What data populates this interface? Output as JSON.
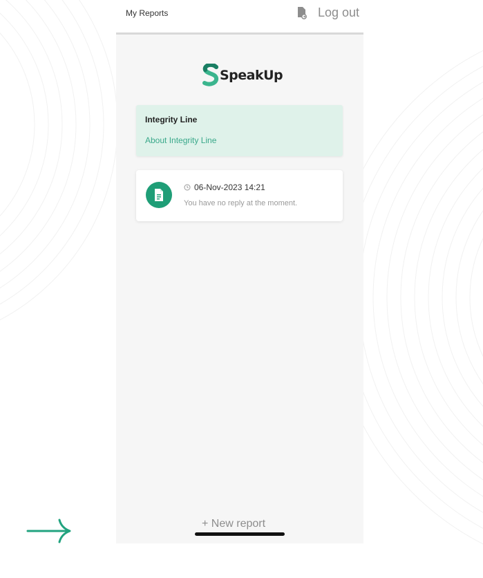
{
  "topbar": {
    "title": "My Reports",
    "logout_label": "Log out"
  },
  "logo": {
    "text": "SpeakUp"
  },
  "organization": {
    "name": "Integrity Line",
    "about_link": "About Integrity Line"
  },
  "reports": [
    {
      "date": "06-Nov-2023 14:21",
      "status": "You have no reply at the moment."
    }
  ],
  "footer": {
    "new_report_label": "+ New report"
  },
  "colors": {
    "accent": "#1f9e77",
    "card_tint": "#dff2ea",
    "link": "#39a88a",
    "arrow": "#22a37f"
  },
  "icons": [
    "report-export-icon",
    "speakup-logo-icon",
    "document-icon",
    "clock-icon",
    "arrow-right-icon"
  ]
}
